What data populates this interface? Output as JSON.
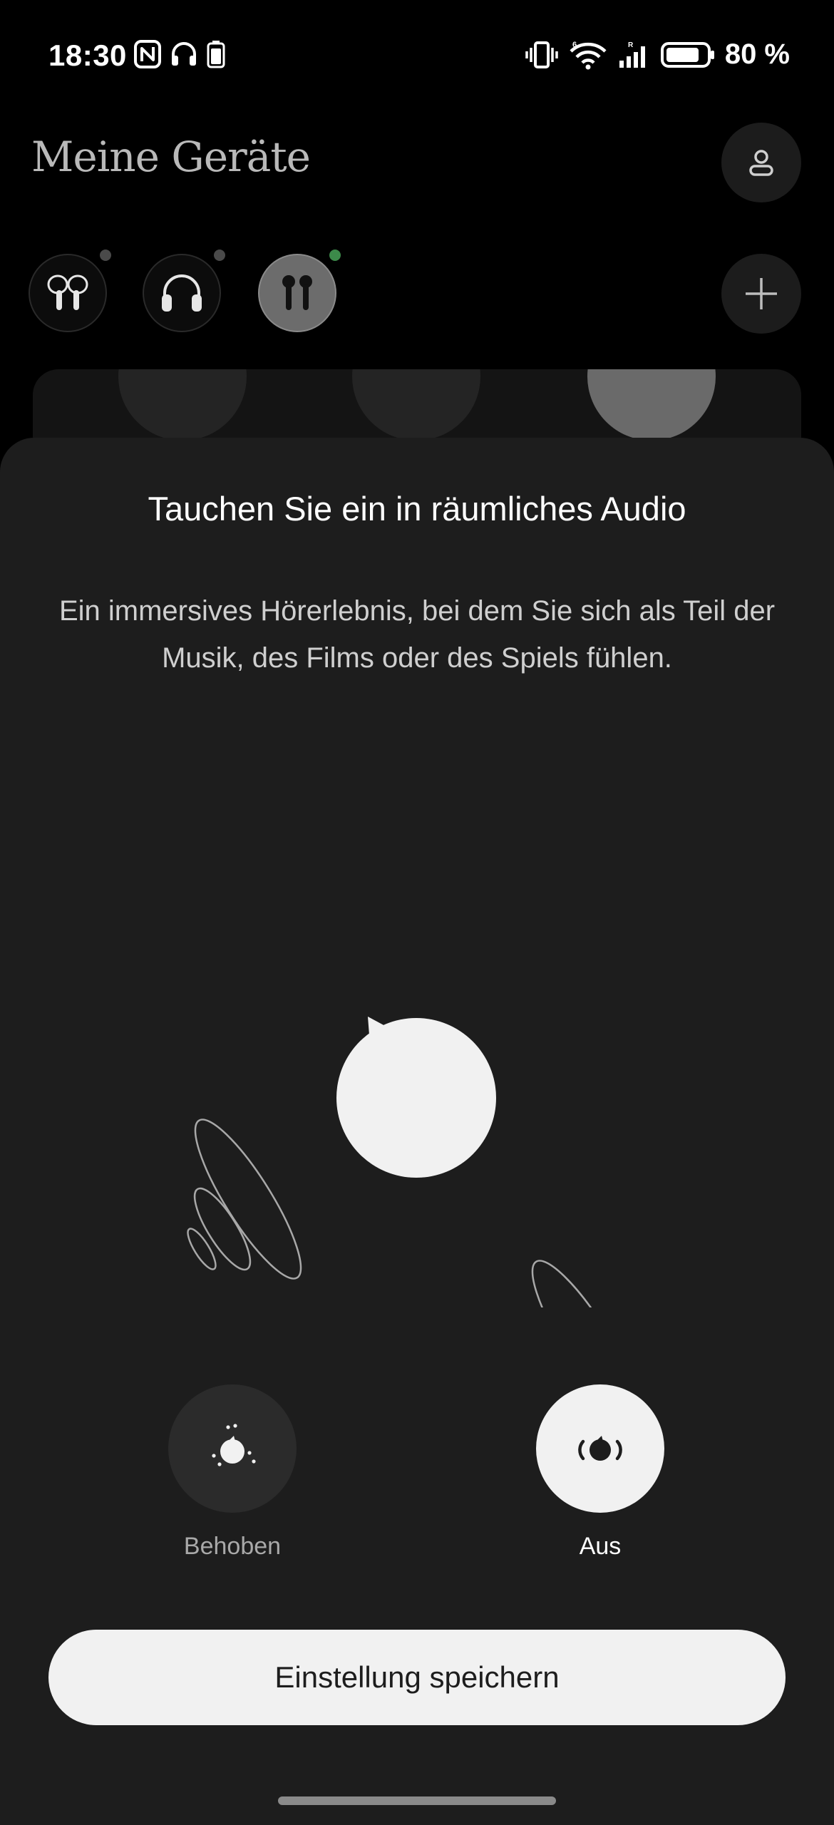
{
  "status_bar": {
    "time": "18:30",
    "battery_percent": "80 %",
    "battery_level": 0.8,
    "icons_left": [
      "nfc-icon",
      "headphones-icon",
      "headset-battery-icon"
    ],
    "icons_right": [
      "vibrate-icon",
      "wifi-icon",
      "signal-icon",
      "battery-icon"
    ]
  },
  "header": {
    "title": "Meine Geräte",
    "profile_icon": "person-icon"
  },
  "devices": [
    {
      "icon": "earbuds-icon",
      "status": "offline"
    },
    {
      "icon": "headphones-icon",
      "status": "offline"
    },
    {
      "icon": "earbuds-stem-icon",
      "status": "online",
      "selected": true
    }
  ],
  "add_device_icon": "plus-icon",
  "colors": {
    "sheet_bg": "#1d1d1d",
    "active_option": "#f1f1f1",
    "inactive_option": "#2b2b2b",
    "online_dot": "#3c8a4a"
  },
  "sheet": {
    "title": "Tauchen Sie ein in räumliches Audio",
    "description": "Ein immersives Hörerlebnis, bei dem Sie sich als Teil der Musik, des Films oder des Spiels fühlen.",
    "options": [
      {
        "label": "Behoben",
        "icon": "spatial-fixed-icon",
        "selected": false
      },
      {
        "label": "Aus",
        "icon": "spatial-off-icon",
        "selected": true
      }
    ],
    "save_label": "Einstellung speichern"
  }
}
